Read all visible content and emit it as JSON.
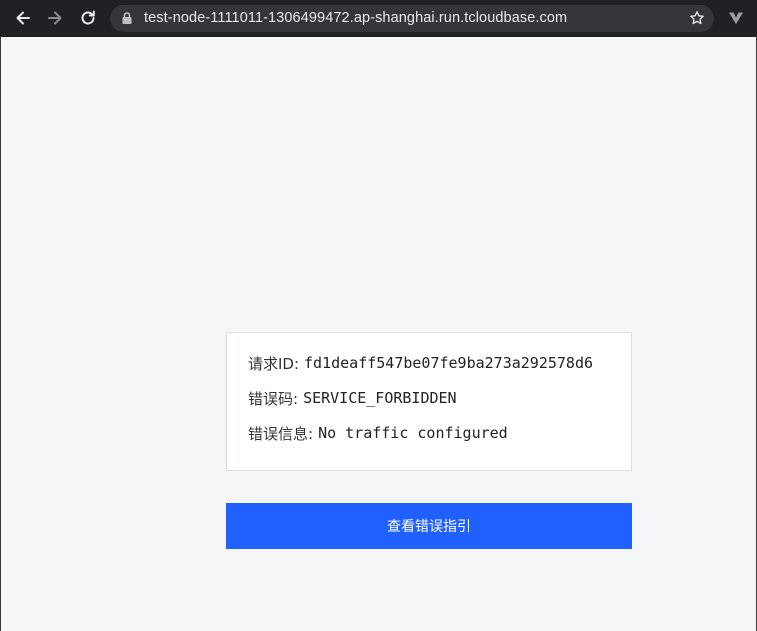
{
  "browser": {
    "url": "test-node-1111011-1306499472.ap-shanghai.run.tcloudbase.com",
    "icons": [
      "back-icon",
      "forward-icon",
      "reload-icon",
      "lock-icon",
      "star-icon",
      "extension-icon"
    ]
  },
  "error": {
    "request_id_label": "请求ID:",
    "request_id": "fd1deaff547be07fe9ba273a292578d6",
    "code_label": "错误码:",
    "code": "SERVICE_FORBIDDEN",
    "message_label": "错误信息:",
    "message": "No traffic configured"
  },
  "actions": {
    "guide_label": "查看错误指引"
  },
  "colors": {
    "toolbar": "#202124",
    "omnibox": "#35363a",
    "page_bg": "#f5f6f8",
    "primary": "#1f60ff"
  }
}
